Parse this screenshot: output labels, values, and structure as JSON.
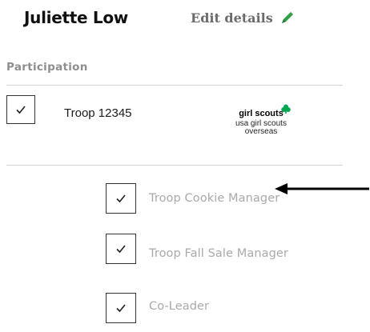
{
  "profile": {
    "name": "Juliette Low",
    "edit_label": "Edit details"
  },
  "section": {
    "title": "Participation"
  },
  "troop": {
    "label": "Troop 12345",
    "checked": true,
    "logo": {
      "brand": "girl scouts",
      "line1": "usa girl scouts",
      "line2": "overseas"
    }
  },
  "roles": [
    {
      "label": "Troop Cookie Manager",
      "checked": true
    },
    {
      "label": "Troop Fall Sale Manager",
      "checked": true
    },
    {
      "label": "Co-Leader",
      "checked": true
    }
  ],
  "icons": {
    "edit": "pencil-icon",
    "check": "check-icon",
    "arrow": "arrow-left-icon",
    "trefoil": "trefoil-icon"
  },
  "colors": {
    "pencil": "#2ea043",
    "trefoil": "#00a651",
    "role_text": "#a9a9a9",
    "section_text": "#8e8e8e"
  }
}
